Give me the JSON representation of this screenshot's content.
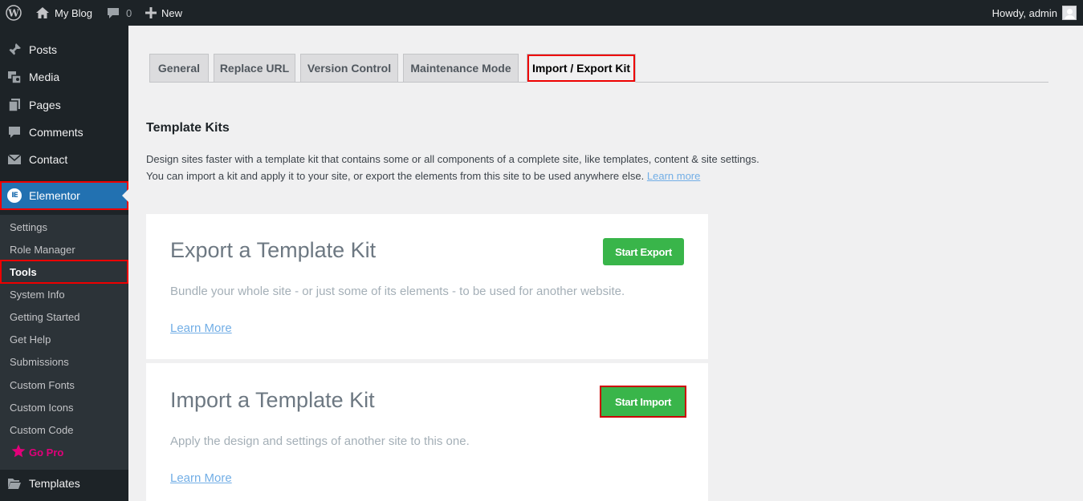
{
  "admin_bar": {
    "site_name": "My Blog",
    "comments_count": "0",
    "new_label": "New",
    "greeting": "Howdy, admin"
  },
  "sidebar": {
    "items": [
      {
        "label": "Posts",
        "icon": "pushpin-icon"
      },
      {
        "label": "Media",
        "icon": "media-icon"
      },
      {
        "label": "Pages",
        "icon": "pages-icon"
      },
      {
        "label": "Comments",
        "icon": "comment-icon"
      },
      {
        "label": "Contact",
        "icon": "envelope-icon"
      },
      {
        "label": "Elementor",
        "icon": "elementor-icon"
      }
    ],
    "elementor_logo_text": "IE",
    "submenu": [
      "Settings",
      "Role Manager",
      "Tools",
      "System Info",
      "Getting Started",
      "Get Help",
      "Submissions",
      "Custom Fonts",
      "Custom Icons",
      "Custom Code",
      "Go Pro"
    ],
    "templates_label": "Templates"
  },
  "tabs": [
    "General",
    "Replace URL",
    "Version Control",
    "Maintenance Mode",
    "Import / Export Kit"
  ],
  "active_tab": "Import / Export Kit",
  "section": {
    "title": "Template Kits",
    "desc_line1": "Design sites faster with a template kit that contains some or all components of a complete site, like templates, content & site settings.",
    "desc_line2": "You can import a kit and apply it to your site, or export the elements from this site to be used anywhere else.",
    "learn_more": "Learn more"
  },
  "export_card": {
    "title": "Export a Template Kit",
    "description": "Bundle your whole site - or just some of its elements - to be used for another website.",
    "learn_more": "Learn More",
    "button": "Start Export"
  },
  "import_card": {
    "title": "Import a Template Kit",
    "description": "Apply the design and settings of another site to this one.",
    "learn_more": "Learn More",
    "button": "Start Import"
  },
  "colors": {
    "admin_dark": "#1d2327",
    "wp_blue": "#2271b1",
    "green_button": "#39b54a",
    "highlight_red": "#e00000",
    "go_pro_pink": "#e2007a"
  }
}
